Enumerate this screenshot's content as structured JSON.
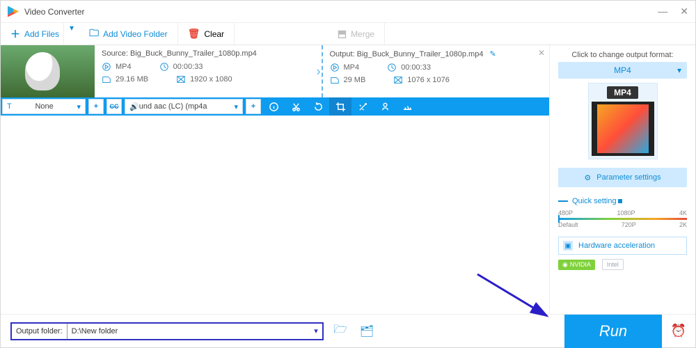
{
  "window": {
    "title": "Video Converter"
  },
  "toolbar": {
    "add_files": "Add Files",
    "add_folder": "Add Video Folder",
    "clear": "Clear",
    "merge": "Merge"
  },
  "item": {
    "source_label": "Source:",
    "source_file": "Big_Buck_Bunny_Trailer_1080p.mp4",
    "source_format": "MP4",
    "source_duration": "00:00:33",
    "source_size": "29.16 MB",
    "source_res": "1920 x 1080",
    "output_label": "Output:",
    "output_file": "Big_Buck_Bunny_Trailer_1080p.mp4",
    "output_format": "MP4",
    "output_duration": "00:00:33",
    "output_size": "29 MB",
    "output_res": "1076 x 1076"
  },
  "edit": {
    "subtitle_value": "None",
    "audio_value": "und aac (LC) (mp4a"
  },
  "right": {
    "caption": "Click to change output format:",
    "format": "MP4",
    "format_tab": "MP4",
    "param_btn": "Parameter settings",
    "quick_label": "Quick setting",
    "ticks_top": [
      "480P",
      "1080P",
      "4K"
    ],
    "ticks_bottom": [
      "Default",
      "720P",
      "2K"
    ],
    "hw_label": "Hardware acceleration",
    "nvidia": "NVIDIA",
    "intel": "Intel"
  },
  "bottom": {
    "out_label": "Output folder:",
    "out_path": "D:\\New folder",
    "run": "Run"
  }
}
